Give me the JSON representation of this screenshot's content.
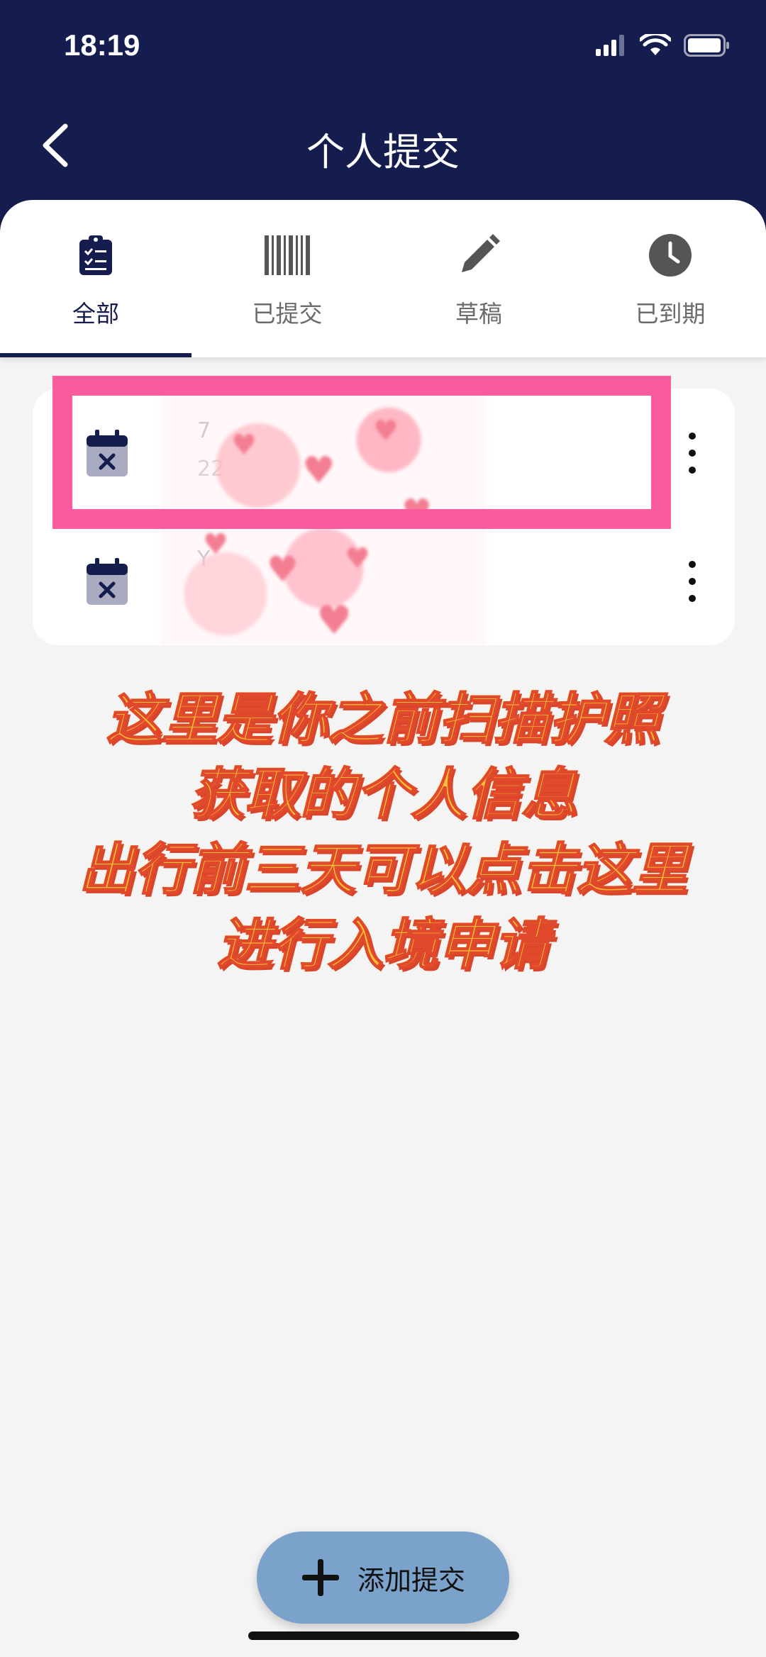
{
  "status_bar": {
    "time": "18:19"
  },
  "header": {
    "title": "个人提交"
  },
  "tabs": [
    {
      "label": "全部",
      "icon": "clipboard-check-icon",
      "active": true
    },
    {
      "label": "已提交",
      "icon": "barcode-icon",
      "active": false
    },
    {
      "label": "草稿",
      "icon": "pencil-icon",
      "active": false
    },
    {
      "label": "已到期",
      "icon": "clock-icon",
      "active": false
    }
  ],
  "submissions": [
    {
      "name": "7",
      "date": "22",
      "icon": "calendar-x-icon"
    },
    {
      "name": "Y",
      "date": "",
      "icon": "calendar-x-icon"
    }
  ],
  "annotation": {
    "lines": [
      "这里是你之前扫描护照",
      "获取的个人信息",
      "出行前三天可以点击这里",
      "进行入境申请"
    ]
  },
  "fab": {
    "label": "添加提交",
    "icon": "plus-icon"
  },
  "colors": {
    "header_bg": "#151c4e",
    "highlight": "#fb5c9f",
    "annotation_text": "#fbbf34",
    "fab_bg": "#7aa2ca"
  }
}
